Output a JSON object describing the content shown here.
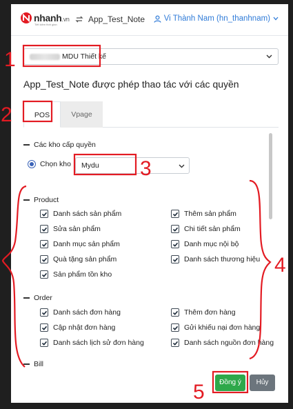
{
  "topbar": {
    "logo_text": "nhanh",
    "logo_suffix": ".vn",
    "logo_tagline": "Tiết kiệm thời gian",
    "app_name": "App_Test_Note",
    "user_name": "Vi Thành Nam (hn_thanhnam)"
  },
  "store": {
    "selected": "MDU Thiết kế"
  },
  "title": "App_Test_Note được phép thao tác với các quyền",
  "tabs": [
    {
      "label": "POS"
    },
    {
      "label": "Vpage"
    }
  ],
  "warehouse": {
    "heading": "Các kho cấp quyền",
    "radio_label": "Chọn kho",
    "selected": "Mydu"
  },
  "sections": {
    "product": {
      "heading": "Product",
      "items": [
        "Danh sách sản phẩm",
        "Thêm sản phẩm",
        "Sửa sản phẩm",
        "Chi tiết sản phẩm",
        "Danh mục sản phẩm",
        "Danh mục nội bộ",
        "Quà tặng sản phẩm",
        "Danh sách thương hiệu",
        "Sản phẩm tồn kho"
      ]
    },
    "order": {
      "heading": "Order",
      "items": [
        "Danh sách đơn hàng",
        "Thêm đơn hàng",
        "Cập nhật đơn hàng",
        "Gửi khiếu nại đơn hàng",
        "Danh sách lịch sử đơn hàng",
        "Danh sách nguồn đơn hàng"
      ]
    },
    "bill": {
      "heading": "Bill"
    }
  },
  "buttons": {
    "ok": "Đồng ý",
    "cancel": "Hủy"
  },
  "annotations": [
    "1",
    "2",
    "3",
    "4",
    "5"
  ],
  "colors": {
    "accent_blue": "#2f7bd8",
    "ok_green": "#2ea84a",
    "cancel_gray": "#6c757d",
    "annotation_red": "#e31b23"
  }
}
